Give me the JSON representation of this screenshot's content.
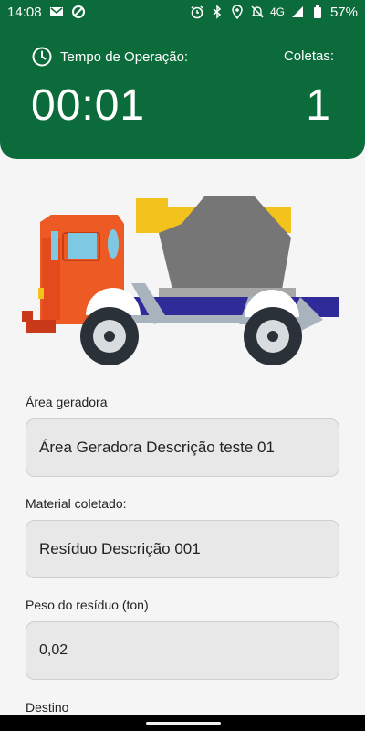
{
  "status_bar": {
    "time": "14:08",
    "network": "4G",
    "battery": "57%",
    "icons": [
      "mail-icon",
      "sync-icon",
      "alarm-icon",
      "bluetooth-icon",
      "location-icon",
      "mute-icon",
      "signal-icon",
      "battery-icon"
    ]
  },
  "header": {
    "timer_label": "Tempo de Operação:",
    "timer_value": "00:01",
    "collections_label": "Coletas:",
    "collections_value": "1",
    "background": "#0b6b3a"
  },
  "form": {
    "area_label": "Área geradora",
    "area_value": "Área Geradora Descrição teste 01",
    "material_label": "Material coletado:",
    "material_value": "Resíduo Descrição 001",
    "weight_label": "Peso do resíduo (ton)",
    "weight_value": "0,02",
    "destination_label": "Destino"
  }
}
